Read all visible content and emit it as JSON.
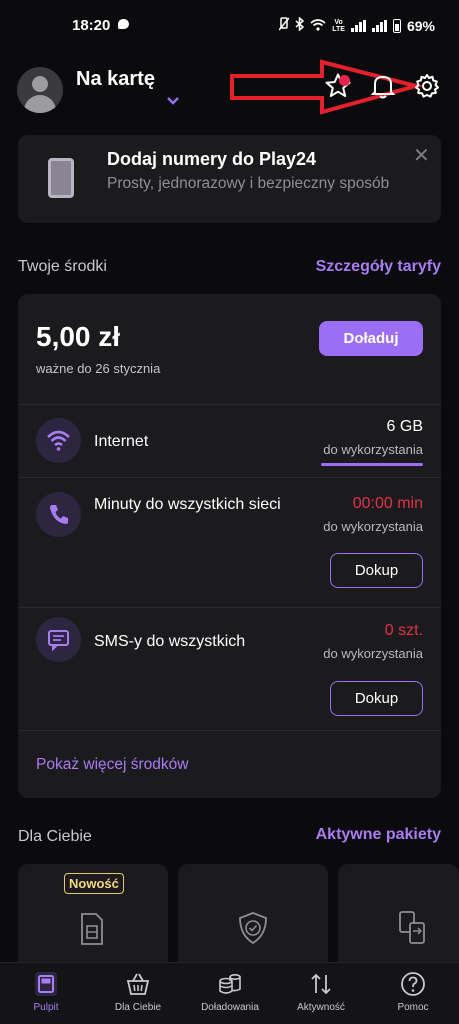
{
  "status_bar": {
    "time": "18:20",
    "battery": "69%",
    "lte_label": "LTE"
  },
  "header": {
    "plan_title": "Na kartę"
  },
  "banner": {
    "title": "Dodaj numery do Play24",
    "subtitle": "Prosty, jednorazowy i bezpieczny sposób",
    "close": "✕"
  },
  "balance_section": {
    "title": "Twoje środki",
    "link": "Szczegóły taryfy"
  },
  "balance": {
    "amount": "5,00 zł",
    "valid_until": "ważne do 26 stycznia",
    "topup_label": "Doładuj"
  },
  "resources": [
    {
      "label": "Internet",
      "value": "6 GB",
      "sub": "do wykorzystania",
      "icon": "wifi-icon",
      "value_color": "#ffffff",
      "progress_fraction": 1.0
    },
    {
      "label": "Minuty do wszystkich sieci",
      "value": "00:00 min",
      "sub": "do wykorzystania",
      "icon": "phone-icon",
      "value_color": "#e0334a",
      "button": "Dokup"
    },
    {
      "label": "SMS-y do wszystkich",
      "value": "0 szt.",
      "sub": "do wykorzystania",
      "icon": "sms-icon",
      "value_color": "#e0334a",
      "button": "Dokup"
    }
  ],
  "more_link": "Pokaż więcej środków",
  "for_you": {
    "title": "Dla Ciebie",
    "link": "Aktywne pakiety",
    "tiles": [
      {
        "badge": "Nowość",
        "icon": "sim-card-icon"
      },
      {
        "icon": "shield-check-icon"
      },
      {
        "icon": "sim-swap-icon"
      }
    ]
  },
  "bottom_nav": [
    {
      "label": "Pulpit",
      "icon": "dashboard-icon",
      "active": true
    },
    {
      "label": "Dla Ciebie",
      "icon": "basket-icon"
    },
    {
      "label": "Doładowania",
      "icon": "coins-icon"
    },
    {
      "label": "Aktywność",
      "icon": "arrows-updown-icon"
    },
    {
      "label": "Pomoc",
      "icon": "help-icon"
    }
  ],
  "colors": {
    "accent": "#9c6ef5",
    "link": "#a87cf2",
    "alert": "#e0334a",
    "card_bg": "#1b1b1e",
    "page_bg": "#0b0b0d"
  }
}
